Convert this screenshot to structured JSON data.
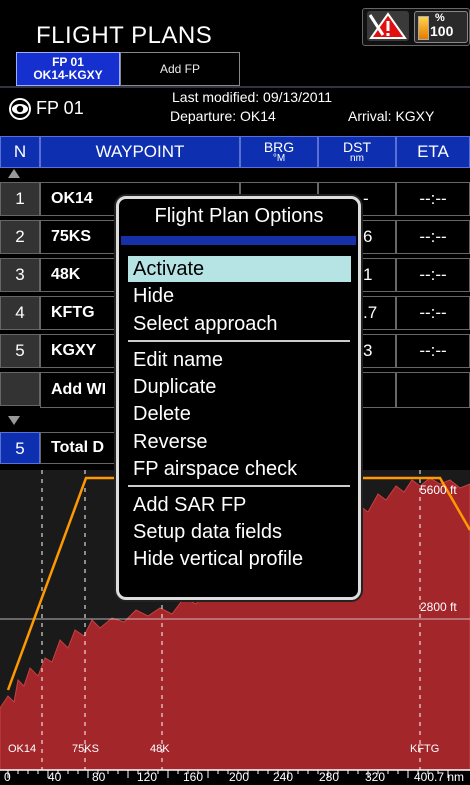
{
  "header": {
    "title": "FLIGHT PLANS",
    "battery_percent_sign": "%",
    "battery_value": "100"
  },
  "icons": {
    "warning": "alert-triangle-icon",
    "eye": "eye-icon",
    "battery": "battery-icon"
  },
  "tabs": [
    {
      "line1": "FP 01",
      "line2": "OK14-KGXY",
      "selected": true
    },
    {
      "line1": "Add FP",
      "line2": "",
      "selected": false
    }
  ],
  "info": {
    "fp_name": "FP 01",
    "last_modified": "Last modified: 09/13/2011",
    "departure": "Departure: OK14",
    "arrival": "Arrival: KGXY"
  },
  "table": {
    "headers": {
      "n": "N",
      "waypoint": "WAYPOINT",
      "brg": "BRG",
      "brg_unit": "°M",
      "dst": "DST",
      "dst_unit": "nm",
      "eta": "ETA"
    },
    "rows": [
      {
        "n": "1",
        "waypoint": "OK14",
        "dst": "-",
        "eta": "--:--"
      },
      {
        "n": "2",
        "waypoint": "75KS",
        "dst": "6",
        "eta": "--:--"
      },
      {
        "n": "3",
        "waypoint": "48K",
        "dst": "1",
        "eta": "--:--"
      },
      {
        "n": "4",
        "waypoint": "KFTG",
        "dst": ".7",
        "eta": "--:--"
      },
      {
        "n": "5",
        "waypoint": "KGXY",
        "dst": "3",
        "eta": "--:--"
      }
    ],
    "add_row_label": "Add WI",
    "total_n": "5",
    "total_label": "Total D"
  },
  "profile": {
    "elev_high": "5600 ft",
    "elev_mid": "2800 ft",
    "waypoints": [
      "OK14",
      "75KS",
      "48K",
      "KFTG"
    ],
    "ticks": [
      "0",
      "40",
      "80",
      "120",
      "160",
      "200",
      "240",
      "280",
      "320",
      "400.7 nm"
    ],
    "colors": {
      "terrain": "#a3262b",
      "route": "#ff9900"
    }
  },
  "menu": {
    "title": "Flight Plan Options",
    "items_group1": [
      "Activate",
      "Hide",
      "Select approach"
    ],
    "items_group2": [
      "Edit name",
      "Duplicate",
      "Delete",
      "Reverse",
      "FP airspace check"
    ],
    "items_group3": [
      "Add SAR FP",
      "Setup data fields",
      "Hide vertical profile"
    ],
    "selected": "Activate",
    "highlight_color": "#b6e3e4"
  }
}
